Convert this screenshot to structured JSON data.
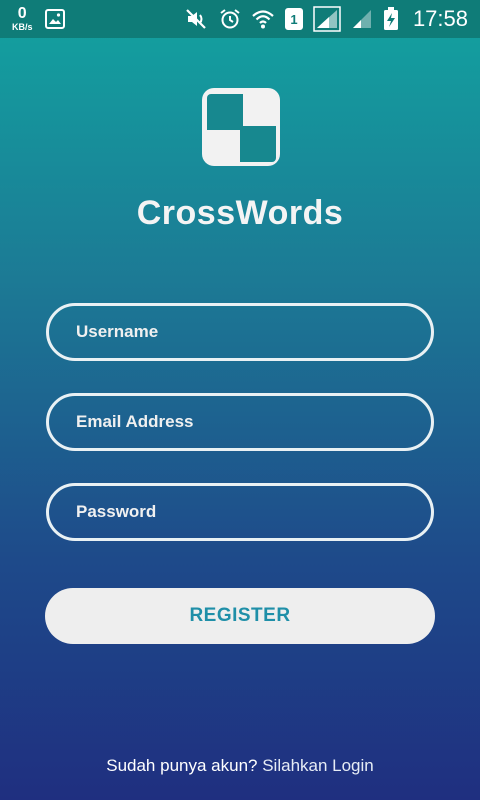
{
  "status_bar": {
    "net_speed_value": "0",
    "net_speed_unit": "KB/s",
    "sim_slot": "1",
    "time": "17:58",
    "icons": [
      "image-icon",
      "mute-icon",
      "alarm-icon",
      "wifi-icon",
      "sim-icon",
      "signal-icon",
      "signal-weak-icon",
      "battery-charging-icon"
    ]
  },
  "app": {
    "title": "CrossWords",
    "logo_icon": "crossword-grid-icon"
  },
  "form": {
    "username_placeholder": "Username",
    "email_placeholder": "Email Address",
    "password_placeholder": "Password",
    "register_label": "REGISTER"
  },
  "footer": {
    "prompt": "Sudah punya akun?",
    "login_link": "Silahkan Login"
  },
  "colors": {
    "gradient_top": "#12a3a0",
    "gradient_bottom": "#1f2f80",
    "status_bar": "#0f7c78",
    "button_bg": "#eeeeee",
    "button_text": "#1f8fa8"
  }
}
